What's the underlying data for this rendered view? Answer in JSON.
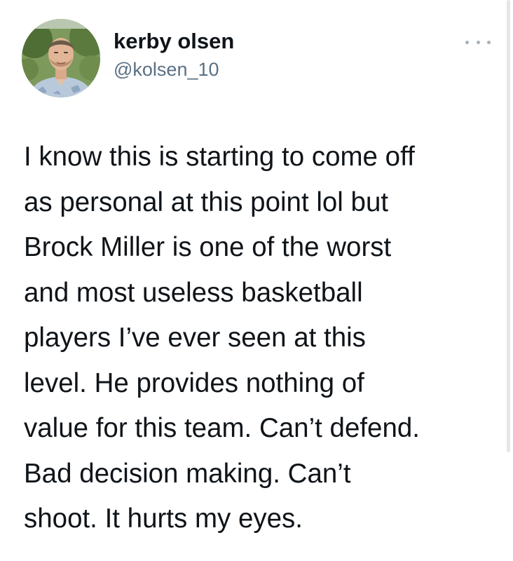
{
  "author": {
    "display_name": "kerby olsen",
    "handle": "@kolsen_10",
    "avatar_icon": "profile-photo"
  },
  "more_icon": "more-dots-icon",
  "tweet": {
    "lines": [
      "I know this is starting to come off",
      "as personal at this point lol but",
      "Brock Miller is one of the worst",
      "and most useless basketball",
      "players I’ve ever seen at this",
      "level. He provides nothing of",
      "value for this team. Can’t defend.",
      "Bad decision making. Can’t",
      "shoot. It hurts my eyes."
    ]
  },
  "colors": {
    "text": "#0f1419",
    "secondary_text": "#5b7083",
    "background": "#ffffff"
  }
}
